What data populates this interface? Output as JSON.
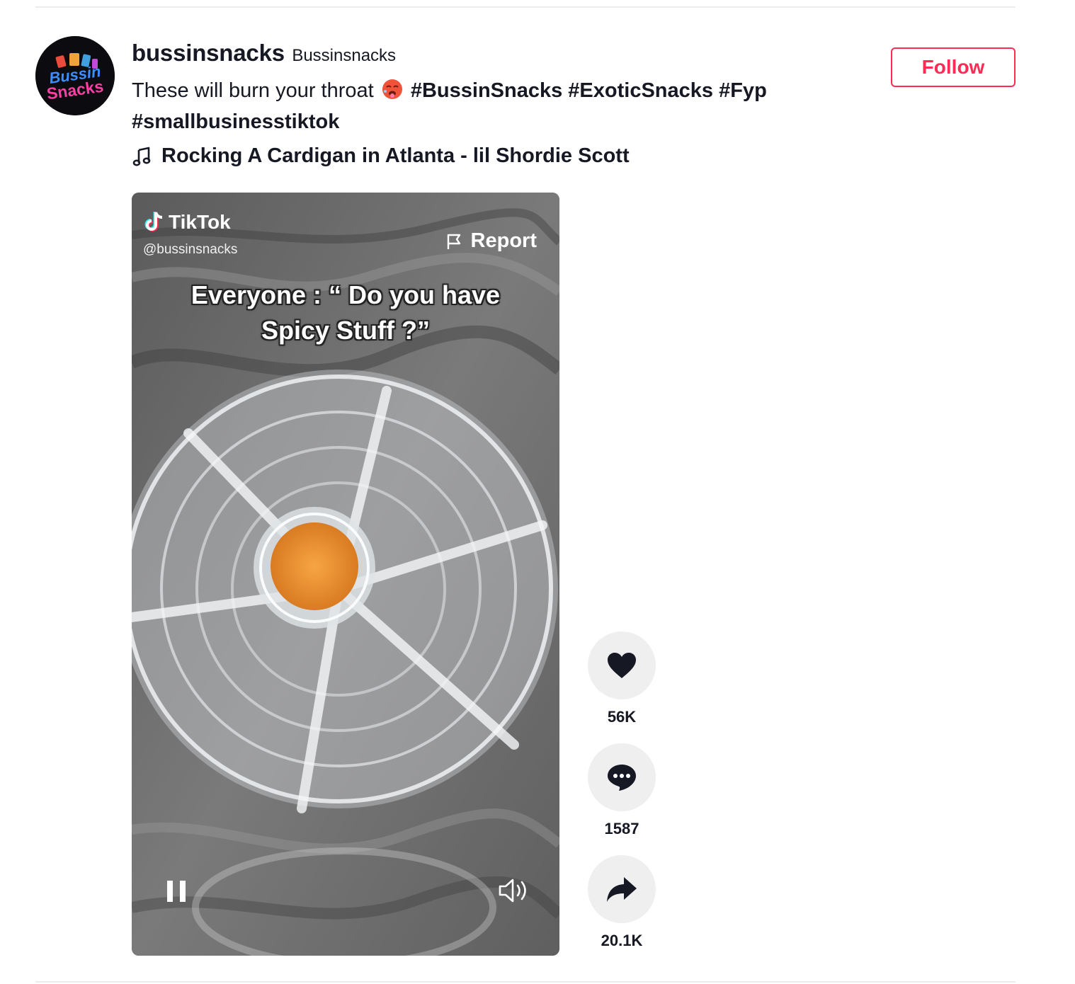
{
  "author": {
    "unique_id": "bussinsnacks",
    "nickname": "Bussinsnacks",
    "avatar_text": [
      "Bussin",
      "Snacks"
    ]
  },
  "follow_label": "Follow",
  "caption": {
    "text": "These will burn your throat",
    "emoji": "hot-face-emoji",
    "hashtags": [
      "#BussinSnacks",
      "#ExoticSnacks",
      "#Fyp",
      "#smallbusinesstiktok"
    ]
  },
  "music": {
    "title": "Rocking A Cardigan in Atlanta - lil Shordie Scott"
  },
  "video": {
    "watermark_brand": "TikTok",
    "watermark_handle": "@bussinsnacks",
    "report_label": "Report",
    "overlay_line1": "Everyone : “ Do you have",
    "overlay_line2": "Spicy Stuff ?”",
    "state": "playing"
  },
  "actions": {
    "likes": "56K",
    "comments": "1587",
    "shares": "20.1K"
  },
  "colors": {
    "accent": "#fe2c55",
    "text": "#161823",
    "action_bg": "#efefef"
  }
}
